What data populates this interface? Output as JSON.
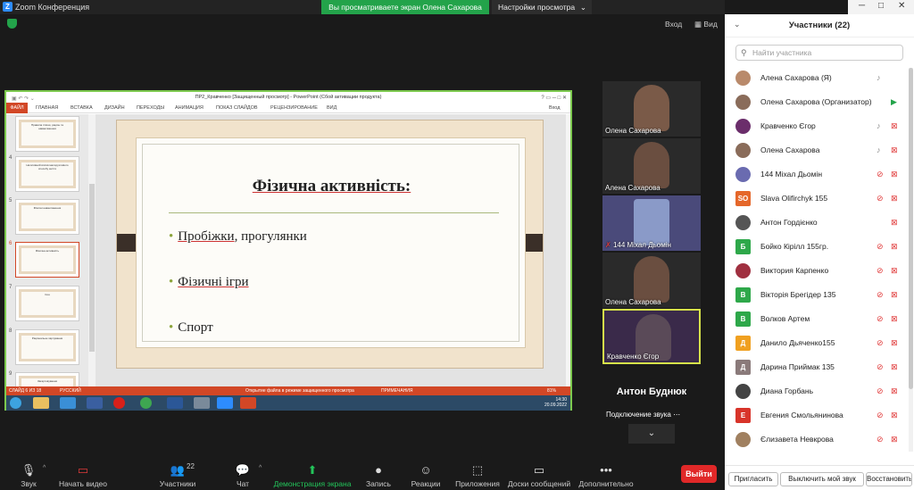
{
  "window": {
    "title": "Zoom Конференция",
    "logo": "Z"
  },
  "banner": {
    "sharing_text": "Вы просматриваете экран Олена Сахарова",
    "view_settings": "Настройки просмотра"
  },
  "overlay": {
    "enter": "Вход",
    "view": "Вид"
  },
  "ppt": {
    "title": "ПР2_Кравченко [Защищенный просмотр] - PowerPoint (Сбой активации продукта)",
    "ribbon_tabs": [
      "ФАЙЛ",
      "ГЛАВНАЯ",
      "ВСТАВКА",
      "ДИЗАЙН",
      "ПЕРЕХОДЫ",
      "АНИМАЦИЯ",
      "ПОКАЗ СЛАЙДОВ",
      "РЕЦЕНЗИРОВАНИЕ",
      "ВИД"
    ],
    "sign_in": "Вход",
    "thumbnails": [
      {
        "num": "",
        "title": "Правила гігієни, раціон та навантаження"
      },
      {
        "num": "4",
        "title": "Негативний вплив малорухливого способу життя"
      },
      {
        "num": "5",
        "title": "Фізичні навантаження"
      },
      {
        "num": "6",
        "title": "Фізична активність"
      },
      {
        "num": "7",
        "title": "Сон"
      },
      {
        "num": "8",
        "title": "Раціональне харчування"
      },
      {
        "num": "9",
        "title": "Загартовування"
      }
    ],
    "slide": {
      "title": "Фізична активність:",
      "bullets": [
        {
          "underlined": "Пробіжки",
          "rest": ", прогулянки"
        },
        {
          "underlined": "Фізичні ігри",
          "rest": ""
        },
        {
          "underlined": "",
          "rest": "Спорт"
        }
      ]
    },
    "status": {
      "slide": "СЛАЙД 6 ИЗ 18",
      "lang": "РУССКИЙ",
      "protected": "Открытие файла в режиме защищенного просмотра",
      "notes": "ПРИМЕЧАНИЯ",
      "zoom": "81%"
    },
    "clock": {
      "time": "14:30",
      "date": "20.09.2022"
    }
  },
  "tiles": [
    {
      "name": "Олена Сахарова"
    },
    {
      "name": "Алена Сахарова"
    },
    {
      "name": "144 Міхал Дьомін"
    },
    {
      "name": "Олена Сахарова"
    },
    {
      "name": "Кравченко Єгор"
    }
  ],
  "audio_tile": {
    "name": "Антон Буднюк",
    "status": "Подключение звука"
  },
  "toolbar": {
    "mute": "Звук",
    "video": "Начать видео",
    "participants": "Участники",
    "participants_count": "22",
    "chat": "Чат",
    "share": "Демонстрация экрана",
    "record": "Запись",
    "reactions": "Реакции",
    "apps": "Приложения",
    "whiteboard": "Доски сообщений",
    "more": "Дополнительно",
    "leave": "Выйти"
  },
  "panel": {
    "title": "Участники (22)",
    "search_placeholder": "Найти участника",
    "participants": [
      {
        "name": "Алена Сахарова (Я)",
        "initials": "",
        "color": "#b98a6b",
        "mic": "on",
        "cam": "none"
      },
      {
        "name": "Олена Сахарова (Организатор)",
        "initials": "",
        "color": "#8a6c5a",
        "mic": "none",
        "cam": "on"
      },
      {
        "name": "Кравченко Єгор",
        "initials": "",
        "color": "#6b2e6b",
        "mic": "on",
        "cam": "off"
      },
      {
        "name": "Олена Сахарова",
        "initials": "",
        "color": "#8a6c5a",
        "mic": "on",
        "cam": "off"
      },
      {
        "name": "144 Міхал Дьомін",
        "initials": "",
        "color": "#6a6bb0",
        "mic": "off",
        "cam": "off"
      },
      {
        "name": "Slava Olifirchyk 155",
        "initials": "SO",
        "color": "#e5672a",
        "mic": "off",
        "cam": "off"
      },
      {
        "name": "Антон Гордієнко",
        "initials": "",
        "color": "#555555",
        "mic": "none",
        "cam": "off"
      },
      {
        "name": "Бойко Кірiлл 155гр.",
        "initials": "Б",
        "color": "#2ea84a",
        "mic": "off",
        "cam": "off"
      },
      {
        "name": "Виктория Карпенко",
        "initials": "",
        "color": "#a03040",
        "mic": "off",
        "cam": "off"
      },
      {
        "name": "Вікторія Брегідер 135",
        "initials": "В",
        "color": "#2ea84a",
        "mic": "off",
        "cam": "off"
      },
      {
        "name": "Волков Артем",
        "initials": "В",
        "color": "#2ea84a",
        "mic": "off",
        "cam": "off"
      },
      {
        "name": "Данило Дьяченко155",
        "initials": "Д",
        "color": "#f0a020",
        "mic": "off",
        "cam": "off"
      },
      {
        "name": "Дарина Приймак 135",
        "initials": "Д",
        "color": "#8a7a7a",
        "mic": "off",
        "cam": "off"
      },
      {
        "name": "Диана Горбань",
        "initials": "",
        "color": "#444444",
        "mic": "off",
        "cam": "off"
      },
      {
        "name": "Евгения Смольянинова",
        "initials": "Е",
        "color": "#d8342a",
        "mic": "off",
        "cam": "off"
      },
      {
        "name": "Єлизавета Невкрова",
        "initials": "",
        "color": "#a08060",
        "mic": "off",
        "cam": "off"
      }
    ],
    "footer": {
      "invite": "Пригласить",
      "mute_me": "Выключить мой звук",
      "restore": "Восстановить"
    }
  }
}
